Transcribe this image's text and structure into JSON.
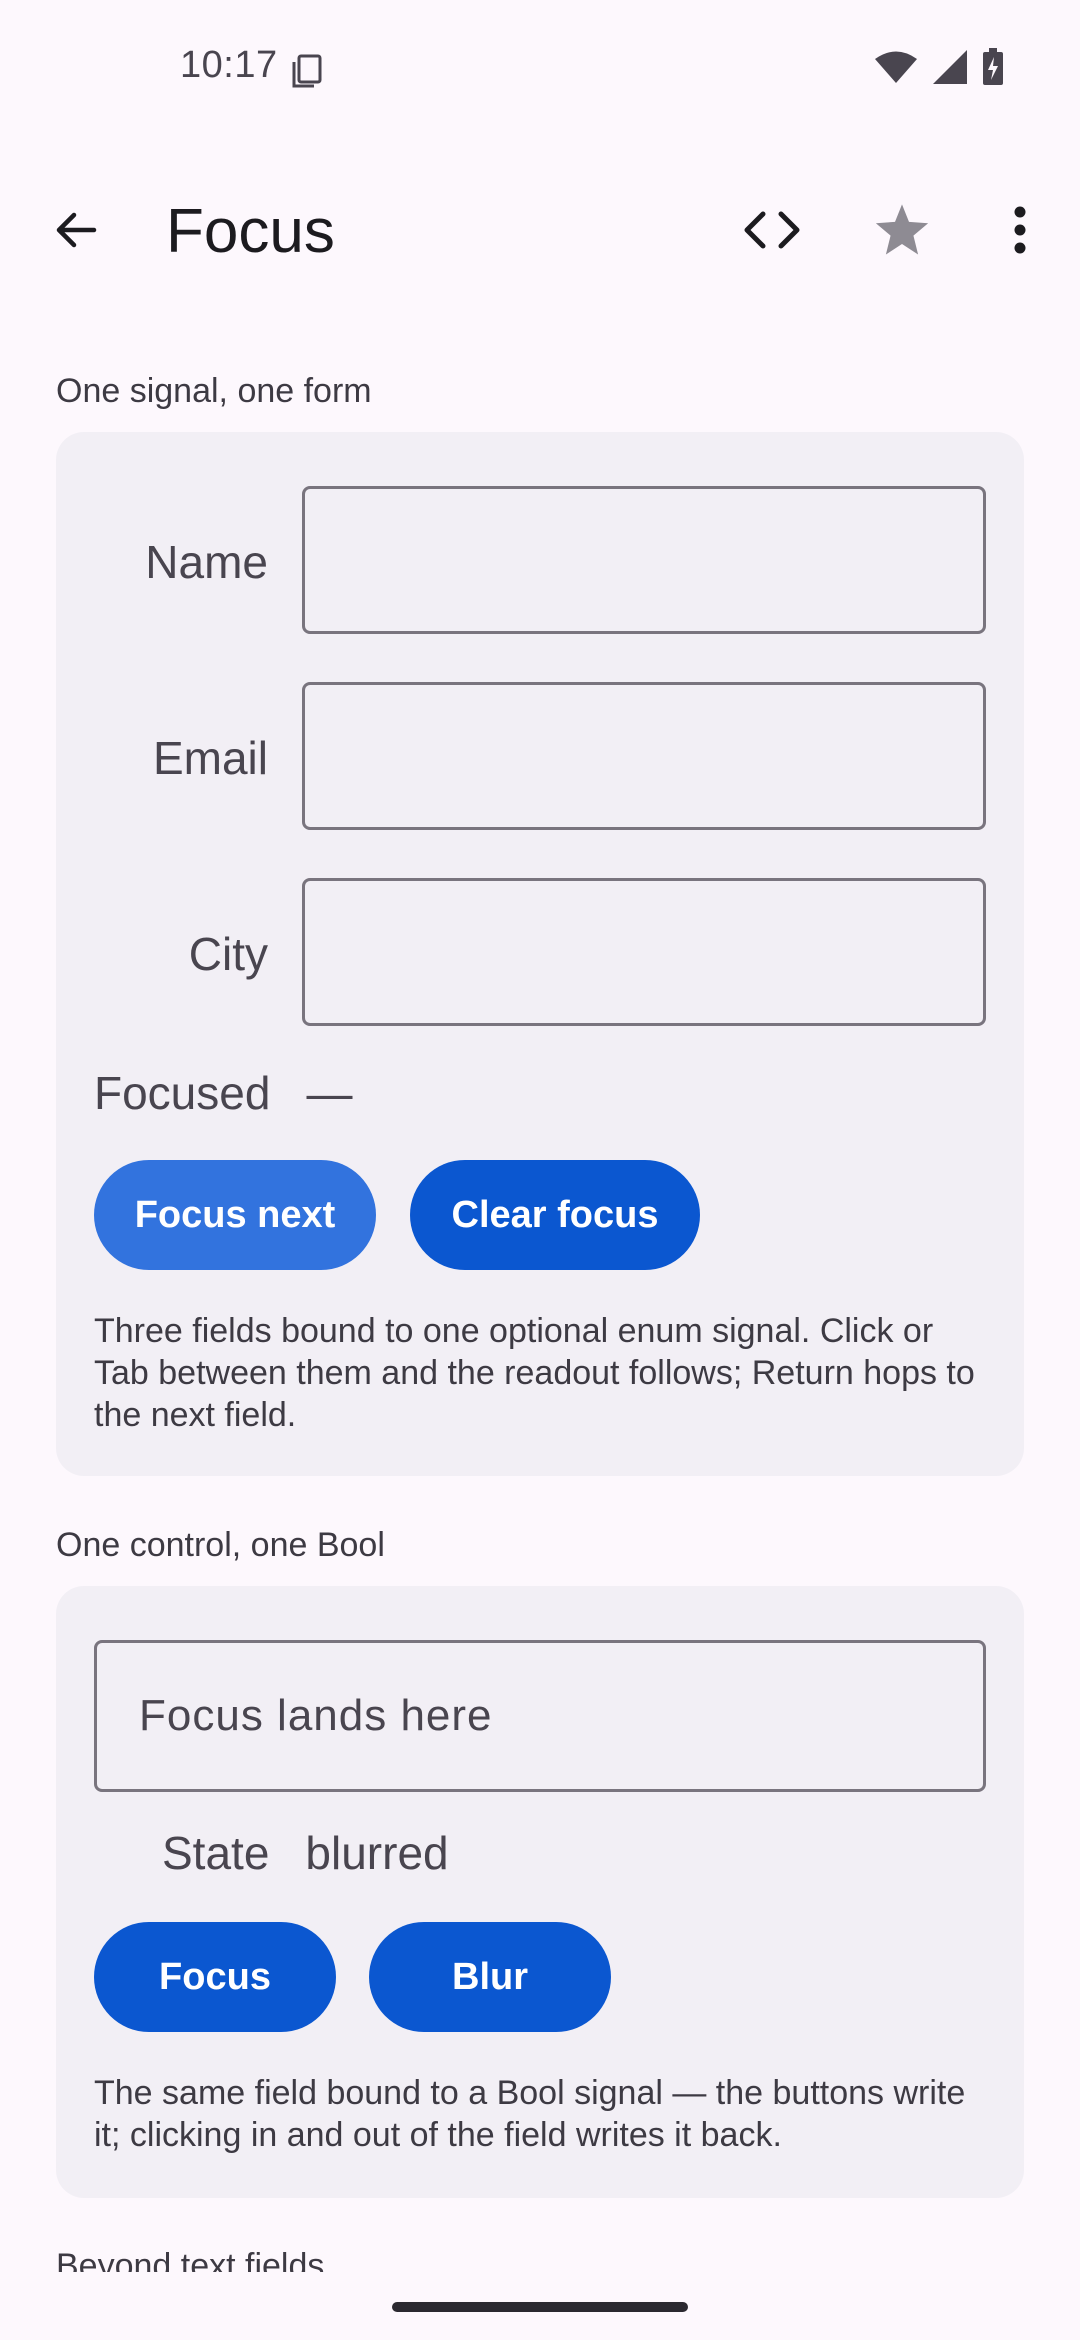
{
  "status_bar": {
    "time": "10:17",
    "icons": [
      "sim-card-icon",
      "wifi-icon",
      "signal-icon",
      "battery-charging-icon"
    ]
  },
  "app_bar": {
    "title": "Focus",
    "actions": [
      "back-arrow-icon",
      "code-brackets-icon",
      "star-icon",
      "more-vertical-icon"
    ]
  },
  "section1": {
    "header": "One signal, one form",
    "fields": [
      {
        "label": "Name",
        "value": ""
      },
      {
        "label": "Email",
        "value": ""
      },
      {
        "label": "City",
        "value": ""
      }
    ],
    "focused_label": "Focused",
    "focused_value": "—",
    "buttons": {
      "focus_next": "Focus next",
      "clear_focus": "Clear focus"
    },
    "description": "Three fields bound to one optional enum signal. Click or Tab between them and the readout follows; Return hops to the next field."
  },
  "section2": {
    "header": "One control, one Bool",
    "field_placeholder": "Focus lands here",
    "state_label": "State",
    "state_value": "blurred",
    "buttons": {
      "focus": "Focus",
      "blur": "Blur"
    },
    "description": "The same field bound to a Bool signal — the buttons write it; clicking in and out of the field writes it back."
  },
  "section3": {
    "header": "Beyond text fields"
  },
  "colors": {
    "primary_button": "#0b57d0",
    "primary_button_light": "#3273de",
    "card_bg": "#f2eff5",
    "page_bg": "#fdf8fd"
  }
}
